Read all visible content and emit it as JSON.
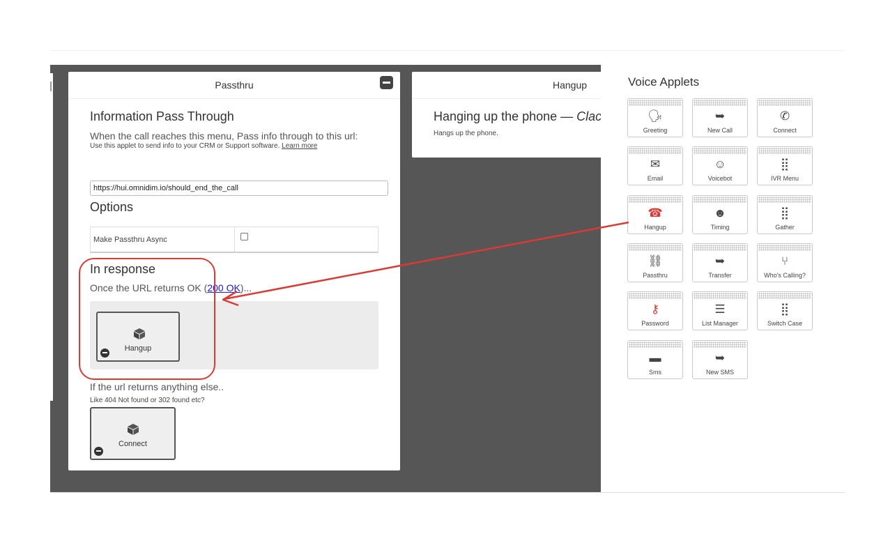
{
  "passthru_card": {
    "header": "Passthru",
    "title": "Information Pass Through",
    "description": "When the call reaches this menu, Pass info through to this url:",
    "help_text": "Use this applet to send info to your CRM or Support software.",
    "learn_more": "Learn more",
    "url_value": "https://hui.omnidim.io/should_end_the_call",
    "options_heading": "Options",
    "async_label": "Make Passthru Async",
    "async_checked": false,
    "response_heading": "In response",
    "ok_prefix": "Once the URL returns OK (",
    "ok_link": "200 OK",
    "ok_suffix": ")...",
    "ok_slot_label": "Hangup",
    "else_text": "If the url returns anything else..",
    "else_example": "Like 404 Not found or 302 found etc?",
    "else_slot_label": "Connect"
  },
  "hangup_card": {
    "header": "Hangup",
    "title_plain": "Hanging up the phone — ",
    "title_italic": "Clac",
    "description": "Hangs up the phone."
  },
  "applets_panel": {
    "title": "Voice Applets",
    "items": [
      {
        "label": "Greeting",
        "icon": "speaking-head-icon",
        "glyph": "🗣"
      },
      {
        "label": "New Call",
        "icon": "forward-arrow-icon",
        "glyph": "➥"
      },
      {
        "label": "Connect",
        "icon": "phone-handset-icon",
        "glyph": "✆"
      },
      {
        "label": "Email",
        "icon": "envelope-icon",
        "glyph": "✉"
      },
      {
        "label": "Voicebot",
        "icon": "robot-icon",
        "glyph": "☺"
      },
      {
        "label": "IVR Menu",
        "icon": "keypad-grid-icon",
        "glyph": "⣿"
      },
      {
        "label": "Hangup",
        "icon": "hangup-phone-icon",
        "glyph": "☎"
      },
      {
        "label": "Timing",
        "icon": "monkey-face-icon",
        "glyph": "☻"
      },
      {
        "label": "Gather",
        "icon": "keypad-grid-icon",
        "glyph": "⣿"
      },
      {
        "label": "Passthru",
        "icon": "chain-link-icon",
        "glyph": "⛓"
      },
      {
        "label": "Transfer",
        "icon": "forward-arrow-icon",
        "glyph": "➥"
      },
      {
        "label": "Who's Calling?",
        "icon": "branch-icon",
        "glyph": "⑂"
      },
      {
        "label": "Password",
        "icon": "key-icon",
        "glyph": "⚷"
      },
      {
        "label": "List Manager",
        "icon": "document-list-icon",
        "glyph": "☰"
      },
      {
        "label": "Switch Case",
        "icon": "keypad-grid-icon",
        "glyph": "⣿"
      },
      {
        "label": "Sms",
        "icon": "message-bubble-icon",
        "glyph": "▬"
      },
      {
        "label": "New SMS",
        "icon": "forward-arrow-icon",
        "glyph": "➥"
      }
    ]
  },
  "colors": {
    "canvas": "#565656",
    "annotation_red": "#d93a33",
    "link_blue": "#1a1ae0"
  }
}
